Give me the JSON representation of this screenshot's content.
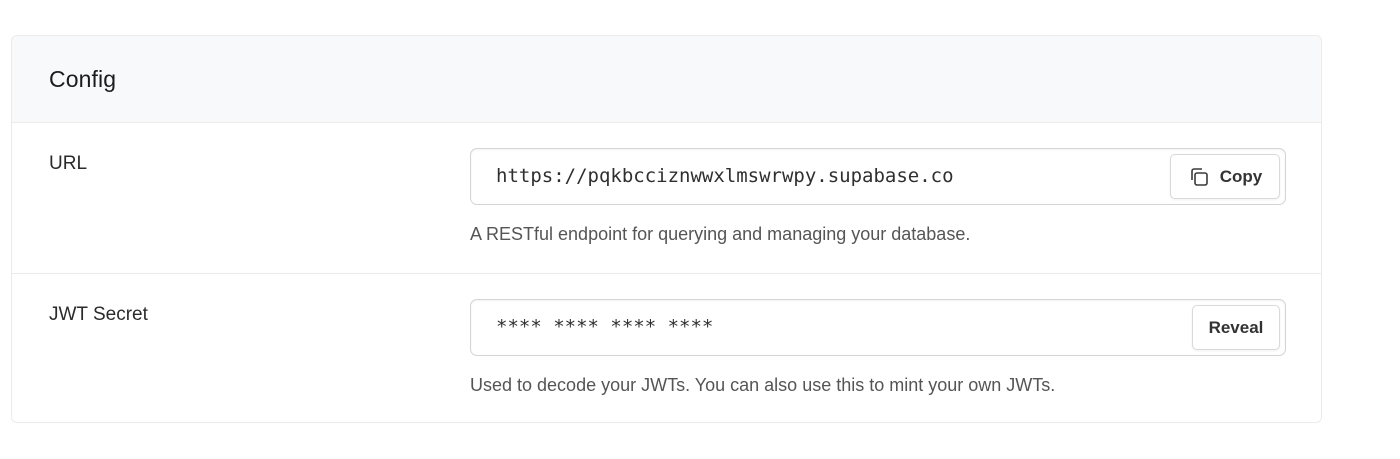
{
  "panel": {
    "title": "Config"
  },
  "rows": [
    {
      "label": "URL",
      "value": "https://pqkbcciznwwxlmswrwpy.supabase.co",
      "button_label": "Copy",
      "button_icon": "copy-icon",
      "help": "A RESTful endpoint for querying and managing your database."
    },
    {
      "label": "JWT Secret",
      "value": "**** **** **** ****",
      "button_label": "Reveal",
      "help": "Used to decode your JWTs. You can also use this to mint your own JWTs."
    }
  ]
}
